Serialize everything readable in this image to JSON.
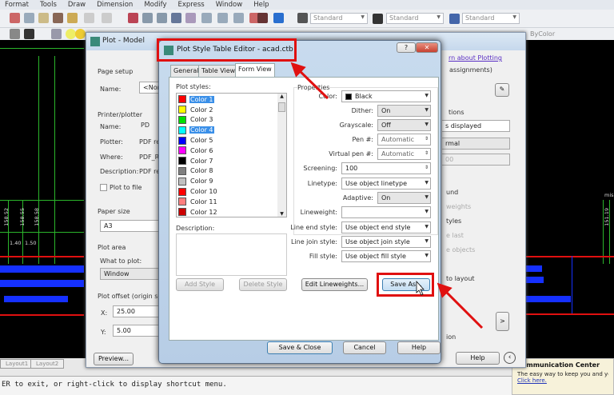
{
  "menubar": [
    "Format",
    "Tools",
    "Draw",
    "Dimension",
    "Modify",
    "Express",
    "Window",
    "Help"
  ],
  "toolbar": {
    "text_style": "Standard",
    "dim_style": "Standard",
    "table_style": "Standard",
    "plot_style": "ByColor"
  },
  "drawing": {
    "values_rotated": [
      "158.52",
      "158.55",
      "158.58"
    ],
    "row_values": [
      "1.40",
      "1.50"
    ],
    "right_label": "151.19",
    "right_text": "mis"
  },
  "layout_tabs": [
    "Layout1",
    "Layout2"
  ],
  "command_line": "ER to exit, or right-click to display shortcut menu.",
  "communication_center": {
    "title": "Communication Center",
    "text": "The easy way to keep you and yo",
    "link": "Click here."
  },
  "plot_dialog": {
    "title": "Plot - Model",
    "page_setup": "Page setup",
    "name_label": "Name:",
    "name_value": "<None",
    "printer_plotter": "Printer/plotter",
    "printer_name_label": "Name:",
    "printer_name_value": "PD",
    "plotter_label": "Plotter:",
    "plotter_value": "PDF re",
    "where_label": "Where:",
    "where_value": "PDF_R",
    "description_label": "Description:",
    "description_value": "PDF re",
    "plot_to_file": "Plot to file",
    "paper_size": "Paper size",
    "paper_size_value": "A3",
    "plot_area": "Plot area",
    "what_to_plot": "What to plot:",
    "what_to_plot_value": "Window",
    "plot_offset": "Plot offset (origin set",
    "x_label": "X:",
    "x_value": "25.00",
    "y_label": "Y:",
    "y_value": "5.00",
    "preview": "Preview...",
    "learn_link": "rn about Plotting",
    "assignments": "assignments)",
    "options": "tions",
    "shade": "s displayed",
    "quality": "rmal",
    "dpi": "00",
    "opt1": "und",
    "opt2": "weights",
    "opt3": "tyles",
    "opt4": "e last",
    "opt5": "e objects",
    "opt6": "to layout",
    "opt7": "ion",
    "help": "Help"
  },
  "pste": {
    "title": "Plot Style Table Editor - acad.ctb",
    "tabs": [
      "General",
      "Table View",
      "Form View"
    ],
    "active_tab": "Form View",
    "plot_styles_label": "Plot styles:",
    "styles": [
      {
        "name": "Color 1",
        "color": "#ff0000",
        "selected": true
      },
      {
        "name": "Color 2",
        "color": "#ffff00"
      },
      {
        "name": "Color 3",
        "color": "#00e000"
      },
      {
        "name": "Color 4",
        "color": "#00ffff",
        "selected": true
      },
      {
        "name": "Color 5",
        "color": "#0000ff"
      },
      {
        "name": "Color 6",
        "color": "#ff00ff"
      },
      {
        "name": "Color 7",
        "color": "#000000"
      },
      {
        "name": "Color 8",
        "color": "#808080"
      },
      {
        "name": "Color 9",
        "color": "#c0c0c0"
      },
      {
        "name": "Color 10",
        "color": "#ff0000"
      },
      {
        "name": "Color 11",
        "color": "#ff7f7f"
      },
      {
        "name": "Color 12",
        "color": "#cc0000"
      }
    ],
    "description_label": "Description:",
    "properties_label": "Properties",
    "color_label": "Color:",
    "color_value": "Black",
    "dither_label": "Dither:",
    "dither_value": "On",
    "grayscale_label": "Grayscale:",
    "grayscale_value": "Off",
    "pen_label": "Pen #:",
    "pen_value": "Automatic",
    "vpen_label": "Virtual pen #:",
    "vpen_value": "Automatic",
    "screening_label": "Screening:",
    "screening_value": "100",
    "linetype_label": "Linetype:",
    "linetype_value": "Use object linetype",
    "adaptive_label": "Adaptive:",
    "adaptive_value": "On",
    "lineweight_label": "Lineweight:",
    "lineweight_value": "",
    "lineend_label": "Line end style:",
    "lineend_value": "Use object end style",
    "linejoin_label": "Line join style:",
    "linejoin_value": "Use object join style",
    "fill_label": "Fill style:",
    "fill_value": "Use object fill style",
    "add_style": "Add Style",
    "delete_style": "Delete Style",
    "edit_lineweights": "Edit Lineweights...",
    "save_as": "Save As...",
    "save_close": "Save & Close",
    "cancel": "Cancel",
    "help": "Help",
    "help_glyph": "?",
    "close_glyph": "✕"
  },
  "colors": {
    "highlight": "#e01010",
    "selection": "#3a8fe8"
  }
}
